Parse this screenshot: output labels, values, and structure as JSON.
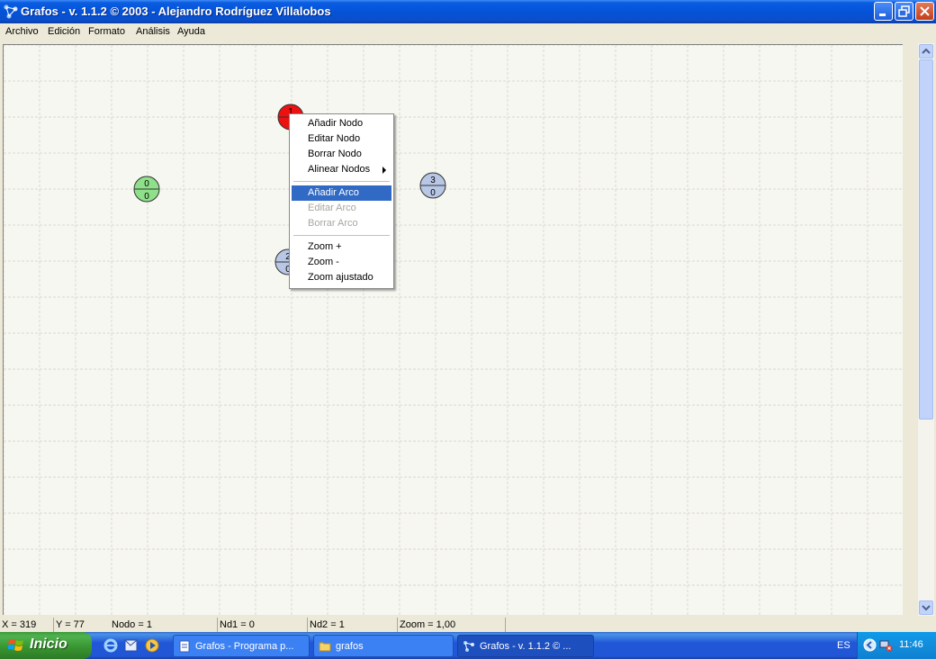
{
  "window": {
    "title": "Grafos - v. 1.1.2  © 2003 - Alejandro Rodríguez Villalobos"
  },
  "menu": [
    "Archivo",
    "Edición",
    "Formato",
    "Análisis",
    "Ayuda"
  ],
  "nodes": [
    {
      "top": "1",
      "bottom": "",
      "color": "#ee1111"
    },
    {
      "top": "0",
      "bottom": "0",
      "color": "#8ee08a"
    },
    {
      "top": "3",
      "bottom": "0",
      "color": "#b9c7e6"
    },
    {
      "top": "2",
      "bottom": "0",
      "color": "#b9c7e6"
    }
  ],
  "context_menu": {
    "items": [
      {
        "label": "Añadir Nodo",
        "state": "normal"
      },
      {
        "label": "Editar Nodo",
        "state": "normal"
      },
      {
        "label": "Borrar Nodo",
        "state": "normal"
      },
      {
        "label": "Alinear Nodos",
        "state": "normal",
        "submenu": true
      },
      {
        "label": "Añadir Arco",
        "state": "selected"
      },
      {
        "label": "Editar Arco",
        "state": "disabled"
      },
      {
        "label": "Borrar Arco",
        "state": "disabled"
      },
      {
        "label": "Zoom +",
        "state": "normal"
      },
      {
        "label": "Zoom -",
        "state": "normal"
      },
      {
        "label": "Zoom ajustado",
        "state": "normal"
      }
    ]
  },
  "status": {
    "x": "X = 319",
    "y": "Y = 77",
    "nodo": "Nodo = 1",
    "nd1": "Nd1 = 0",
    "nd2": "Nd2 = 1",
    "zoom": "Zoom = 1,00"
  },
  "taskbar": {
    "start_label": "Inicio",
    "tasks": [
      {
        "label": "Grafos -   Programa p...",
        "active": false
      },
      {
        "label": "grafos",
        "active": false
      },
      {
        "label": "Grafos - v. 1.1.2  © ...",
        "active": true
      }
    ],
    "language": "ES",
    "clock": "11:46"
  },
  "colors": {
    "selection": "#316ac5",
    "grid": "#d8d8cf",
    "titlebar": "#0453d8"
  }
}
